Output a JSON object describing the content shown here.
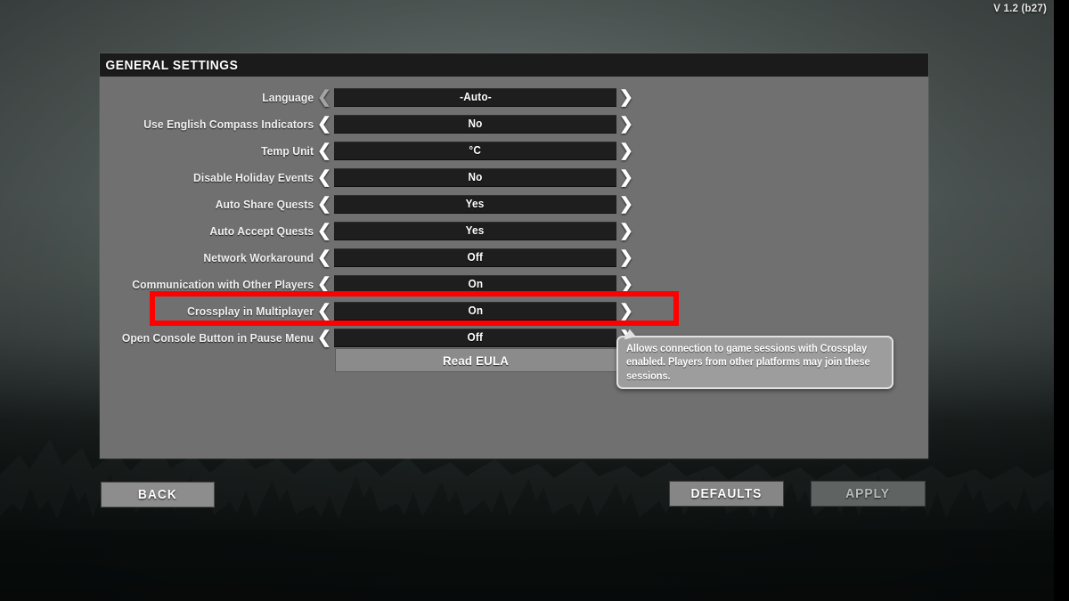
{
  "version_label": "V 1.2 (b27)",
  "panel": {
    "title": "GENERAL SETTINGS",
    "settings": [
      {
        "label": "Language",
        "value": "-Auto-",
        "left_arrow": "❮",
        "right_arrow": "❯",
        "left_dim": true
      },
      {
        "label": "Use English Compass Indicators",
        "value": "No",
        "left_arrow": "❮",
        "right_arrow": "❯",
        "left_dim": false
      },
      {
        "label": "Temp Unit",
        "value": "°C",
        "left_arrow": "❮",
        "right_arrow": "❯",
        "left_dim": false
      },
      {
        "label": "Disable Holiday Events",
        "value": "No",
        "left_arrow": "❮",
        "right_arrow": "❯",
        "left_dim": false
      },
      {
        "label": "Auto Share Quests",
        "value": "Yes",
        "left_arrow": "❮",
        "right_arrow": "❯",
        "left_dim": false
      },
      {
        "label": "Auto Accept Quests",
        "value": "Yes",
        "left_arrow": "❮",
        "right_arrow": "❯",
        "left_dim": false
      },
      {
        "label": "Network Workaround",
        "value": "Off",
        "left_arrow": "❮",
        "right_arrow": "❯",
        "left_dim": false
      },
      {
        "label": "Communication with Other Players",
        "value": "On",
        "left_arrow": "❮",
        "right_arrow": "❯",
        "left_dim": false
      },
      {
        "label": "Crossplay in Multiplayer",
        "value": "On",
        "left_arrow": "❮",
        "right_arrow": "❯",
        "left_dim": false
      },
      {
        "label": "Open Console Button in Pause Menu",
        "value": "Off",
        "left_arrow": "❮",
        "right_arrow": "❯",
        "left_dim": false
      }
    ],
    "eula_label": "Read EULA"
  },
  "highlight": {
    "target_setting": "Crossplay in Multiplayer",
    "color": "#ff0000"
  },
  "tooltip": {
    "text": "Allows connection to game sessions with Crossplay enabled. Players from other platforms may join these sessions."
  },
  "footer": {
    "back_label": "BACK",
    "defaults_label": "DEFAULTS",
    "apply_label": "APPLY",
    "apply_disabled": true
  }
}
